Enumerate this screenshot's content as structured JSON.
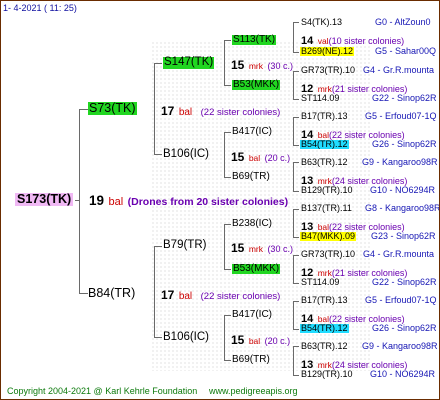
{
  "header": {
    "text": "1-   4-2021  (  11:  25)"
  },
  "footer": {
    "copyright": "Copyright 2004-2021 @ Karl Kehrle Foundation",
    "url": "www.pedigreeapis.org"
  },
  "root": {
    "queen": "S173(TK)",
    "number": "19",
    "unit": "bal",
    "note": "(Drones from 20 sister colonies)"
  },
  "sire1": {
    "label": "S73(TK)",
    "number": "17",
    "unit": "bal",
    "colonies": "(22 sister colonies)"
  },
  "sire2": {
    "label": "B84(TR)",
    "number": "17",
    "unit": "bal",
    "colonies": "(22 sister colonies)"
  },
  "col3": {
    "a": "S147(TK)",
    "b": "B106(IC)",
    "c": "B79(TR)",
    "d": "B106(IC)",
    "a_num": "15",
    "a_unit": "mrk",
    "a_col": "(30 c.)",
    "b_num": "15",
    "b_unit": "bal",
    "b_col": "(20 c.)",
    "c_num": "15",
    "c_unit": "mrk",
    "c_col": "(30 c.)",
    "d_num": "15",
    "d_unit": "bal",
    "d_col": "(20 c.)"
  },
  "col4": {
    "r1": "S113(TK)",
    "r2": "B53(MKK)",
    "r3": "B417(IC)",
    "r4": "B69(TR)",
    "r5": "B238(IC)",
    "r6": "B53(MKK)",
    "r7": "B417(IC)",
    "r8": "B69(TR)"
  },
  "right": {
    "r1": {
      "name": "S4(TK).13",
      "code": "G0 - AltZoun0"
    },
    "r1m": {
      "num": "14",
      "unit": "val",
      "col": "(10 sister colonies)"
    },
    "r1b": {
      "name": "B269(NE).12",
      "code": "G5 - Sahar00Q"
    },
    "r2": {
      "name": "GR73(TR).10",
      "code": "G4 - Gr.R.mounta"
    },
    "r2m": {
      "num": "12",
      "unit": "mrk",
      "col": "(21 sister colonies)"
    },
    "r2b": {
      "name": "ST114.09",
      "code": "G22 - Sinop62R"
    },
    "r3": {
      "name": "B17(TR).13",
      "code": "G5 - Erfoud07-1Q"
    },
    "r3m": {
      "num": "14",
      "unit": "bal",
      "col": "(22 sister colonies)"
    },
    "r3b": {
      "name": "B54(TR).12",
      "code": "G26 - Sinop62R"
    },
    "r4": {
      "name": "B63(TR).12",
      "code": "G9 - Kangaroo98R"
    },
    "r4m": {
      "num": "13",
      "unit": "mrk",
      "col": "(24 sister colonies)"
    },
    "r4b": {
      "name": "B129(TR).10",
      "code": "G10 - NO6294R"
    },
    "r5": {
      "name": "B137(TR).11",
      "code": "G8 - Kangaroo98R"
    },
    "r5m": {
      "num": "13",
      "unit": "bal",
      "col": "(22 sister colonies)"
    },
    "r5b": {
      "name": "B47(MKK).09",
      "code": "G23 - Sinop62R"
    },
    "r6": {
      "name": "GR73(TR).10",
      "code": "G4 - Gr.R.mounta"
    },
    "r6m": {
      "num": "12",
      "unit": "mrk",
      "col": "(21 sister colonies)"
    },
    "r6b": {
      "name": "ST114.09",
      "code": "G22 - Sinop62R"
    },
    "r7": {
      "name": "B17(TR).13",
      "code": "G5 - Erfoud07-1Q"
    },
    "r7m": {
      "num": "14",
      "unit": "bal",
      "col": "(22 sister colonies)"
    },
    "r7b": {
      "name": "B54(TR).12",
      "code": "G26 - Sinop62R"
    },
    "r8": {
      "name": "B63(TR).12",
      "code": "G9 - Kangaroo98R"
    },
    "r8m": {
      "num": "13",
      "unit": "mrk",
      "col": "(24 sister colonies)"
    },
    "r8b": {
      "name": "B129(TR).10",
      "code": "G10 - NO6294R"
    }
  },
  "colors": {
    "root_bg": "#f0b8f4",
    "green": "#21d621",
    "yellow": "#ffff00",
    "cyan": "#20dcff",
    "footer": "#0c7a0c",
    "blue": "#1515b4",
    "red": "#cc0000"
  }
}
